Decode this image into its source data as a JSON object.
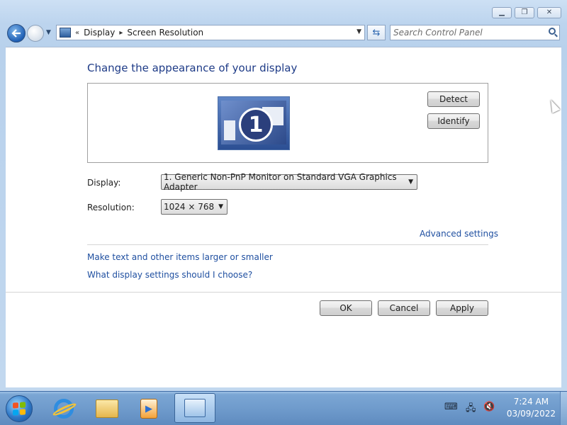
{
  "window": {
    "caption_buttons": {
      "minimize": "minimize-icon",
      "maximize": "maximize-icon",
      "close": "close-icon"
    }
  },
  "address_bar": {
    "chevron": "«",
    "breadcrumbs": [
      "Display",
      "Screen Resolution"
    ],
    "separator": "▸",
    "search_placeholder": "Search Control Panel"
  },
  "content": {
    "title": "Change the appearance of your display",
    "monitor_number": "1",
    "detect_label": "Detect",
    "identify_label": "Identify",
    "display_label": "Display:",
    "display_value": "1. Generic Non-PnP Monitor on Standard VGA Graphics Adapter",
    "resolution_label": "Resolution:",
    "resolution_value": "1024 × 768",
    "advanced_link": "Advanced settings",
    "link_text_size": "Make text and other items larger or smaller",
    "link_help": "What display settings should I choose?",
    "ok_label": "OK",
    "cancel_label": "Cancel",
    "apply_label": "Apply"
  },
  "taskbar": {
    "pinned": [
      "internet-explorer-icon",
      "windows-explorer-icon",
      "media-player-icon",
      "control-panel-icon"
    ],
    "tray_icons": [
      "keyboard-icon",
      "network-icon",
      "volume-muted-icon"
    ],
    "time": "7:24 AM",
    "date": "03/09/2022"
  },
  "colors": {
    "title": "#1e3b87",
    "link": "#1f4fa0",
    "frame": "#bcd4ee",
    "taskbar": "#6f9bcc"
  }
}
